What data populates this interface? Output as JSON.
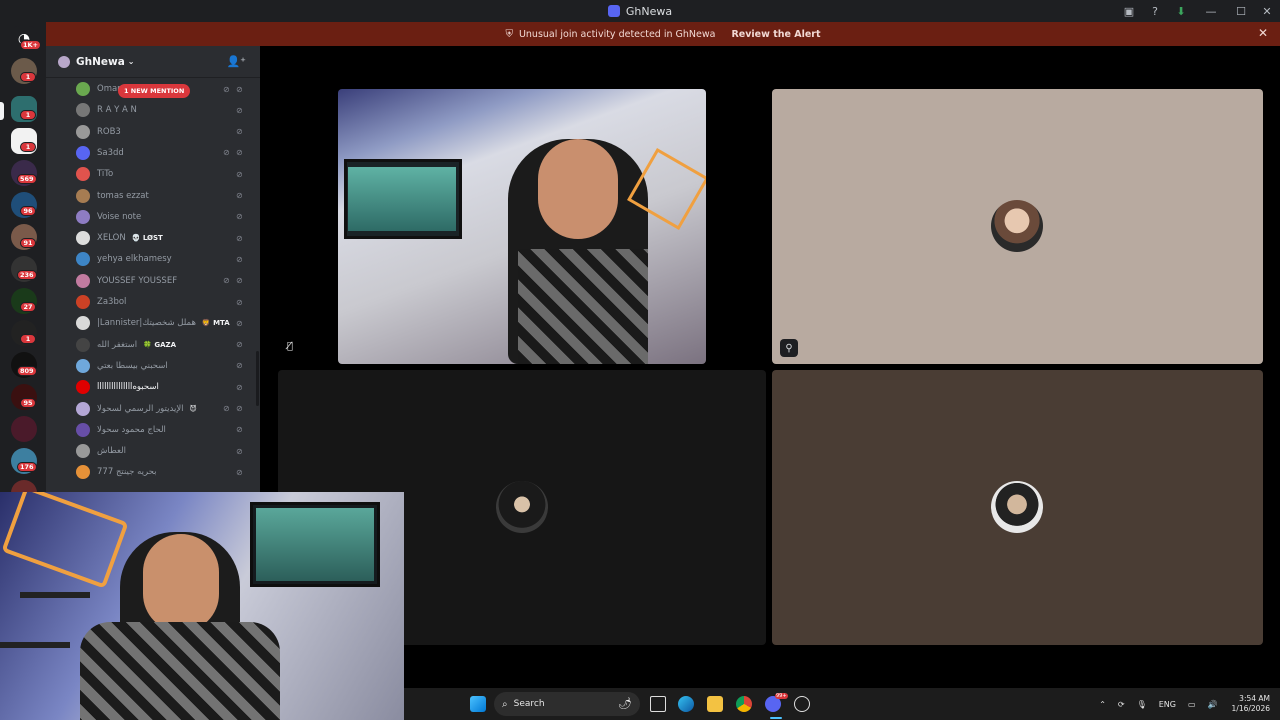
{
  "window": {
    "title": "GhNewa"
  },
  "alert": {
    "text": "Unusual join activity detected in GhNewa",
    "action": "Review the Alert"
  },
  "rail": {
    "badges": [
      "1K+",
      "1",
      "1",
      "1",
      "569",
      "96",
      "91",
      "236",
      "27",
      "1",
      "809",
      "95",
      "176"
    ]
  },
  "server": {
    "name": "GhNewa",
    "mention_badge": "1 NEW MENTION"
  },
  "members": [
    {
      "name": "Omar",
      "color": "#6aa84f"
    },
    {
      "name": "R A Y A N",
      "color": "#777777"
    },
    {
      "name": "ROB3",
      "color": "#999999"
    },
    {
      "name": "Sa3dd",
      "color": "#5865f2"
    },
    {
      "name": "TiTo",
      "color": "#e0534d"
    },
    {
      "name": "tomas ezzat",
      "color": "#a67c52"
    },
    {
      "name": "Voise note",
      "color": "#8e7cc3"
    },
    {
      "name": "XELON",
      "tag": "💀 LØST",
      "color": "#dddddd"
    },
    {
      "name": "yehya elkhamesy",
      "color": "#3d85c6"
    },
    {
      "name": "YOUSSEF YOUSSEF",
      "color": "#c27ba0"
    },
    {
      "name": "Za3bol",
      "color": "#cc4125"
    },
    {
      "name": "|Lannister|هملل شخصيتك",
      "tag": "🦁 MTA",
      "color": "#d9d9d9"
    },
    {
      "name": "استغفر الله",
      "tag": "🍀 GAZA",
      "color": "#444444"
    },
    {
      "name": "اسحبني بيسطا بعتي",
      "color": "#6fa8dc"
    },
    {
      "name": "lllllllllllllllاسحبوه",
      "color": "#e00000"
    },
    {
      "name": "الإيديتور الرسمي لسحولا",
      "tag": "😈",
      "color": "#b4a7d6"
    },
    {
      "name": "الحاج محمود سحولا",
      "color": "#674ea7"
    },
    {
      "name": "العطاش",
      "color": "#999999"
    },
    {
      "name": "777 بحريه جينتج",
      "color": "#e69138"
    }
  ],
  "taskbar": {
    "search_placeholder": "Search",
    "language": "ENG",
    "time": "3:54 AM",
    "date": "1/16/2026",
    "discord_badge": "99+"
  },
  "icons": {
    "window": [
      "discord-app-icon",
      "screen-share-icon",
      "help-icon",
      "download-icon",
      "minimize-icon",
      "maximize-icon",
      "close-icon"
    ],
    "alert": [
      "shield-alert-icon",
      "close-icon"
    ],
    "member": [
      "muted-mic-icon",
      "deafened-icon"
    ],
    "tile": [
      "muted-mic-icon",
      "activity-icon"
    ]
  }
}
